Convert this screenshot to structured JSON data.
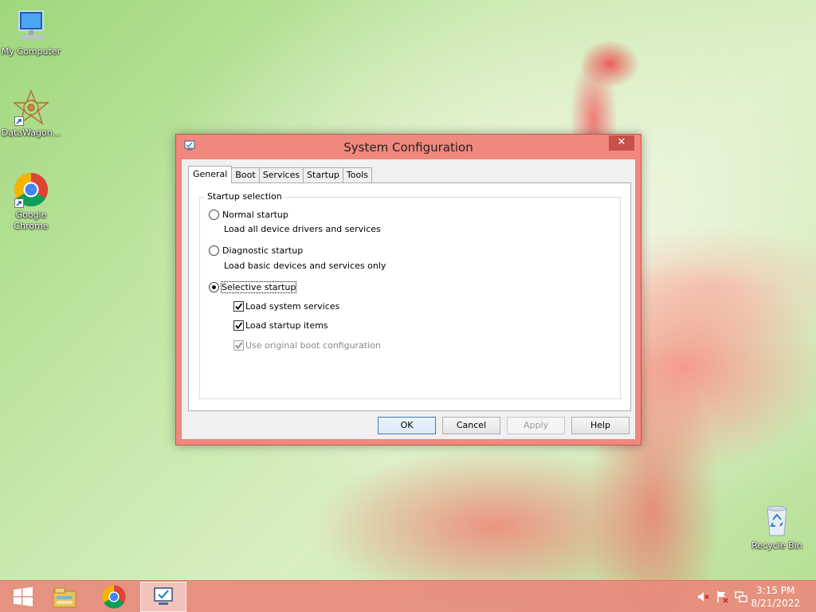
{
  "desktop": {
    "icons": [
      {
        "label": "My Computer"
      },
      {
        "label": "DataWagon..."
      },
      {
        "label": "Google Chrome"
      },
      {
        "label": "Recycle Bin"
      }
    ]
  },
  "dialog": {
    "title": "System Configuration",
    "close_symbol": "✕",
    "tabs": [
      {
        "label": "General",
        "active": true
      },
      {
        "label": "Boot"
      },
      {
        "label": "Services"
      },
      {
        "label": "Startup"
      },
      {
        "label": "Tools"
      }
    ],
    "group_label": "Startup selection",
    "options": {
      "normal": {
        "label": "Normal startup",
        "description": "Load all device drivers and services",
        "selected": false
      },
      "diagnostic": {
        "label": "Diagnostic startup",
        "description": "Load basic devices and services only",
        "selected": false
      },
      "selective": {
        "label": "Selective startup",
        "selected": true
      }
    },
    "checks": {
      "system_services": {
        "label": "Load system services",
        "checked": true
      },
      "startup_items": {
        "label": "Load startup items",
        "checked": true
      },
      "original_boot": {
        "label": "Use original boot configuration",
        "checked": true,
        "disabled": true
      }
    },
    "buttons": {
      "ok": "OK",
      "cancel": "Cancel",
      "apply": "Apply",
      "help": "Help"
    }
  },
  "taskbar": {
    "items": [
      {
        "icon": "file-explorer-icon"
      },
      {
        "icon": "chrome-icon"
      },
      {
        "icon": "system-configuration-icon",
        "active": true
      }
    ],
    "tray": [
      "volume-muted-icon",
      "action-center-flag-icon",
      "network-icon"
    ],
    "clock": {
      "time": "3:15 PM",
      "date": "8/21/2022"
    }
  },
  "colors": {
    "accent": "#f0887d",
    "close": "#c7504a",
    "default_button_border": "#3c7fb1"
  }
}
